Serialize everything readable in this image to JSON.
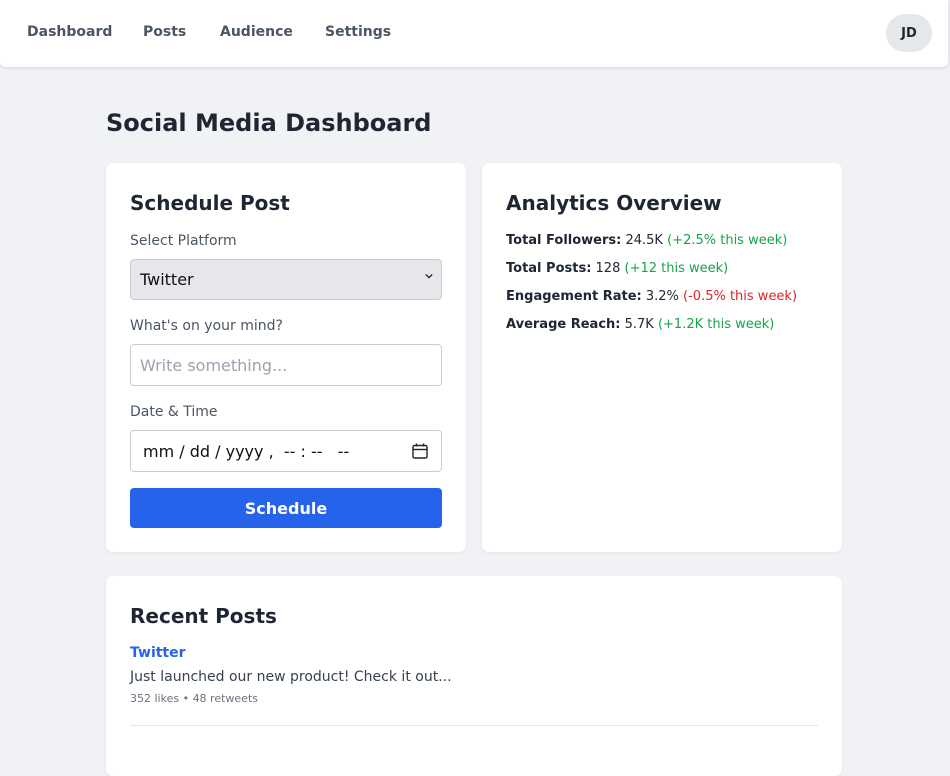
{
  "nav": {
    "links": [
      "Dashboard",
      "Posts",
      "Audience",
      "Settings"
    ],
    "avatar_initials": "JD"
  },
  "page": {
    "title": "Social Media Dashboard"
  },
  "schedule": {
    "title": "Schedule Post",
    "platform_label": "Select Platform",
    "platform_value": "Twitter",
    "content_label": "What's on your mind?",
    "content_placeholder": "Write something...",
    "datetime_label": "Date & Time",
    "datetime_value": "mm / dd / yyyy ,  -- : --   --",
    "button_label": "Schedule"
  },
  "analytics": {
    "title": "Analytics Overview",
    "stats": [
      {
        "label": "Total Followers:",
        "value": "24.5K",
        "change": "(+2.5% this week)",
        "trend": "up"
      },
      {
        "label": "Total Posts:",
        "value": "128",
        "change": "(+12 this week)",
        "trend": "up"
      },
      {
        "label": "Engagement Rate:",
        "value": "3.2%",
        "change": "(-0.5% this week)",
        "trend": "down"
      },
      {
        "label": "Average Reach:",
        "value": "5.7K",
        "change": "(+1.2K this week)",
        "trend": "up"
      }
    ]
  },
  "recent": {
    "title": "Recent Posts",
    "posts": [
      {
        "platform": "Twitter",
        "text": "Just launched our new product! Check it out...",
        "meta": "352 likes • 48 retweets"
      }
    ]
  },
  "colors": {
    "accent": "#2563eb",
    "positive": "#16a34a",
    "negative": "#dc2626",
    "background": "#f0f2f5"
  }
}
